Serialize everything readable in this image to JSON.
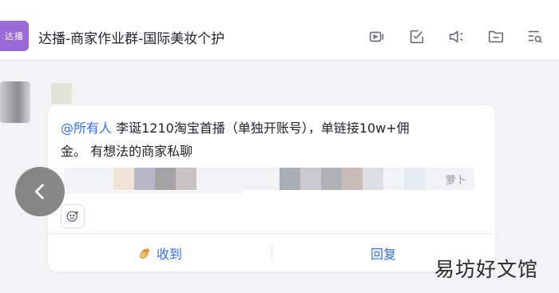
{
  "header": {
    "group_avatar_text": "达播",
    "title": "达播-商家作业群-国际美妆个护",
    "icons": [
      "video-icon",
      "task-check-icon",
      "announcement-icon",
      "folder-icon",
      "search-list-icon"
    ]
  },
  "message": {
    "mention": "@所有人",
    "text_line1": " 李诞1210淘宝首播（单独开账号），单链接10w+佣",
    "text_line2": "金。 有想法的商家私聊",
    "quote_author": "萝卜",
    "actions": {
      "ack_label": "收到",
      "reply_label": "回复"
    }
  },
  "watermark": "易坊好文馆",
  "colors": {
    "accent": "#3370ff",
    "avatar": "#9b6ad9"
  }
}
